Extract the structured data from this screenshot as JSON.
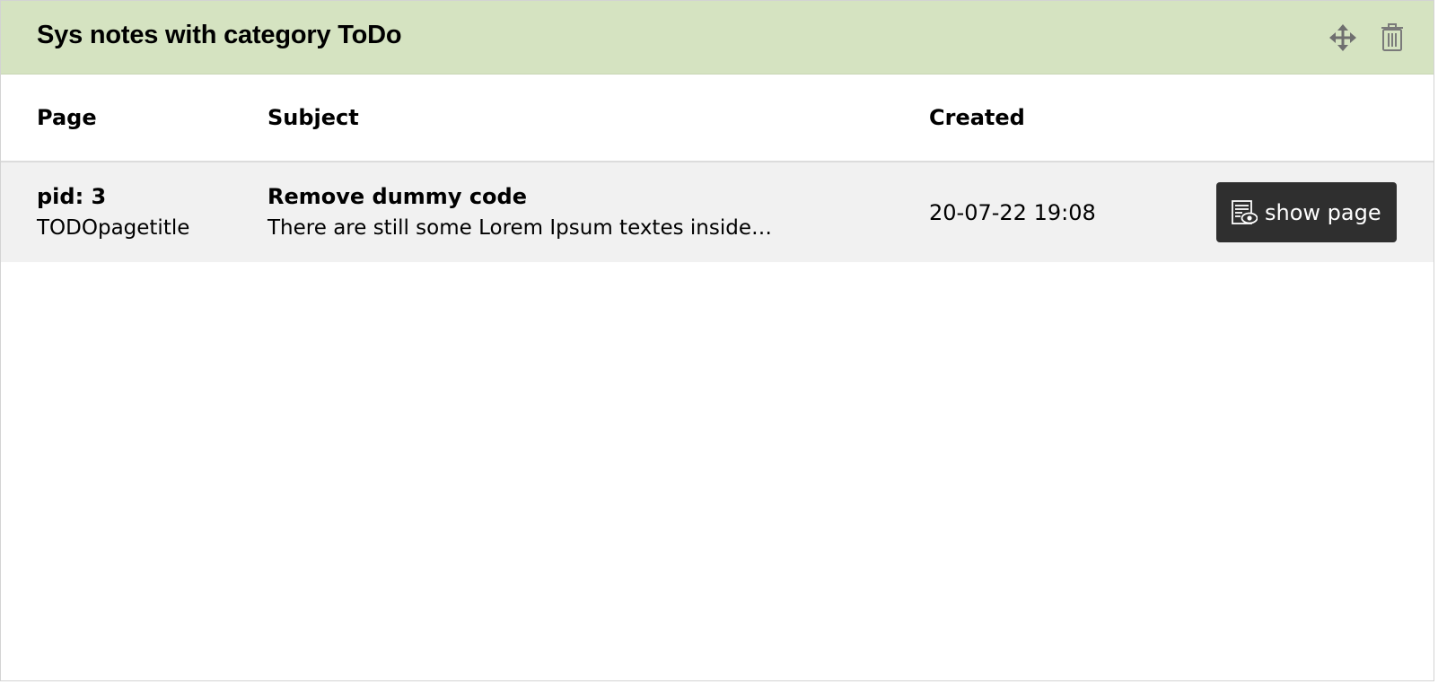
{
  "widget": {
    "title": "Sys notes with category ToDo",
    "header_bg": "#d5e3c1",
    "actions": [
      {
        "name": "move",
        "icon": "move-arrows-icon"
      },
      {
        "name": "delete",
        "icon": "trash-icon"
      }
    ]
  },
  "table": {
    "columns": {
      "page": "Page",
      "subject": "Subject",
      "created": "Created"
    },
    "rows": [
      {
        "pid": "pid: 3",
        "page_title": "TODOpagetitle",
        "subject_title": "Remove dummy code",
        "subject_text": "There are still some Lorem Ipsum textes inside…",
        "created": "20-07-22 19:08",
        "action_label": "show page",
        "action_icon": "page-preview-icon"
      }
    ]
  }
}
